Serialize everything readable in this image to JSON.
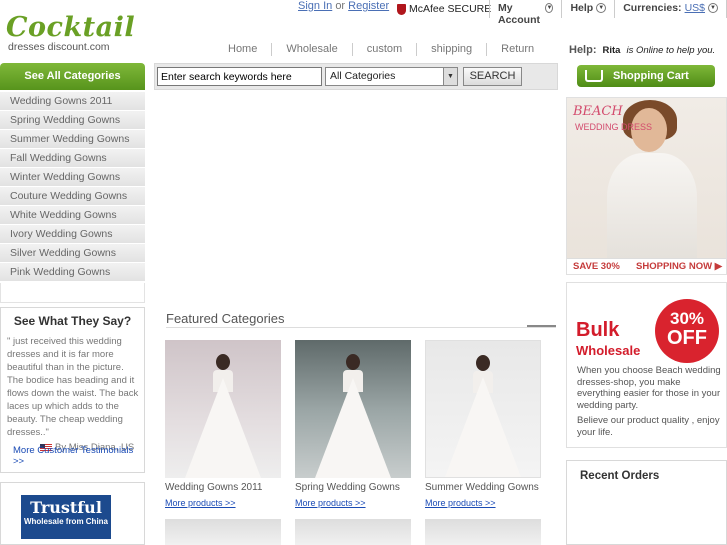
{
  "logo": {
    "line1": "Cocktail",
    "line2": "dresses discount.com"
  },
  "auth": {
    "sign_in": "Sign In",
    "or": "or",
    "register": "Register"
  },
  "mcafee": "McAfee SECURE",
  "topmenu": {
    "account": "My Account",
    "help": "Help",
    "currencies": "Currencies:",
    "currency_value": "US$"
  },
  "nav": [
    "Home",
    "Wholesale",
    "custom",
    "shipping",
    "Return"
  ],
  "help": {
    "label": "Help:",
    "agent": "Rita",
    "status": "is Online to help you."
  },
  "categories_button": "See All Categories",
  "search": {
    "value": "Enter search keywords here",
    "category": "All Categories",
    "button": "SEARCH"
  },
  "cart": "Shopping Cart",
  "sidebar": [
    "Wedding Gowns 2011",
    "Spring Wedding Gowns",
    "Summer Wedding Gowns",
    "Fall Wedding Gowns",
    "Winter Wedding Gowns",
    "Couture Wedding Gowns",
    "White Wedding Gowns",
    "Ivory Wedding Gowns",
    "Silver Wedding Gowns",
    "Pink Wedding Gowns"
  ],
  "testimonial": {
    "title": "See What They Say?",
    "quote": "\" just received this wedding dresses and it is far more beautiful than in the picture. The bodice has beading and it flows down the waist. The back laces up which adds to the beauty. The cheap wedding dresses..\"",
    "author": "By Miss Diana, US",
    "more": "More Customer Testimonials >>"
  },
  "trust": {
    "line1": "Trustful",
    "line2": "Wholesale from China"
  },
  "featured": {
    "title": "Featured Categories",
    "items": [
      {
        "name": "Wedding Gowns 2011",
        "more": "More products >>"
      },
      {
        "name": "Spring Wedding Gowns",
        "more": "More products >>"
      },
      {
        "name": "Summer Wedding Gowns",
        "more": "More products >>"
      }
    ]
  },
  "beach_banner": {
    "title": "BEACH",
    "subtitle": "WEDDING DRESS",
    "save": "SAVE 30%",
    "shop": "SHOPPING NOW ▶"
  },
  "bulk": {
    "title": "Bulk",
    "subtitle": "Wholesale",
    "percent": "30%",
    "off": "OFF",
    "text1": "When you choose Beach wedding dresses-shop, you make everything easier for those in your wedding party.",
    "text2": "Believe our product quality , enjoy your life."
  },
  "recent_orders": "Recent Orders",
  "colors": {
    "brand_green": "#6aa025",
    "accent_red": "#d31c2b",
    "link_blue": "#1a4bb5"
  }
}
